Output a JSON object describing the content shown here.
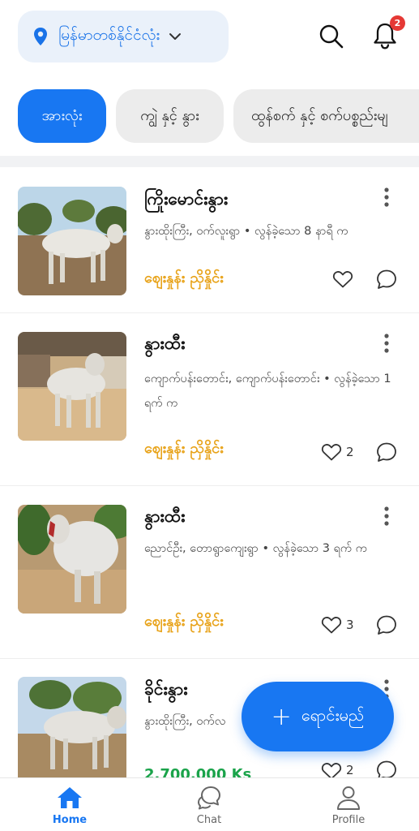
{
  "header": {
    "location": "မြန်မာတစ်နိုင်ငံလုံး",
    "notification_count": "2"
  },
  "categories": [
    {
      "label": "အားလုံး",
      "active": true
    },
    {
      "label": "ကျွဲ နှင့် နွား",
      "active": false
    },
    {
      "label": "ထွန်စက် နှင့် စက်ပစ္စည်းမျ",
      "active": false
    }
  ],
  "listings": [
    {
      "title": "ကြိုးမောင်းနွား",
      "meta": "နွားထိုးကြီး, ဝက်လူးရွာ • လွန်ခဲ့သော 8 နာရီ က",
      "price": "ဈေးနှုန်း ညှိနှိုင်း",
      "likes": ""
    },
    {
      "title": "နွားထီး",
      "meta": "ကျောက်ပန်းတောင်း, ကျောက်ပန်းတောင်း • လွန်ခဲ့သော 1 ရက် က",
      "price": "ဈေးနှုန်း ညှိနှိုင်း",
      "likes": "2"
    },
    {
      "title": "နွားထီး",
      "meta": "ညောင်ဦး, တောရွာကျေးရွာ • လွန်ခဲ့သော 3 ရက် က",
      "price": "ဈေးနှုန်း ညှိနှိုင်း",
      "likes": "3"
    },
    {
      "title": "ခိုင်းနွား",
      "meta": "နွားထိုးကြီး, ဝက်လ",
      "price": "2,700,000 Ks",
      "likes": "2"
    }
  ],
  "fab": {
    "label": "ရောင်းမည်"
  },
  "nav": [
    {
      "label": "Home",
      "active": true
    },
    {
      "label": "Chat",
      "active": false
    },
    {
      "label": "Profile",
      "active": false
    }
  ],
  "colors": {
    "accent": "#1877f2",
    "price": "#e8a31a",
    "price_green": "#1aa34a",
    "badge": "#e53935"
  }
}
